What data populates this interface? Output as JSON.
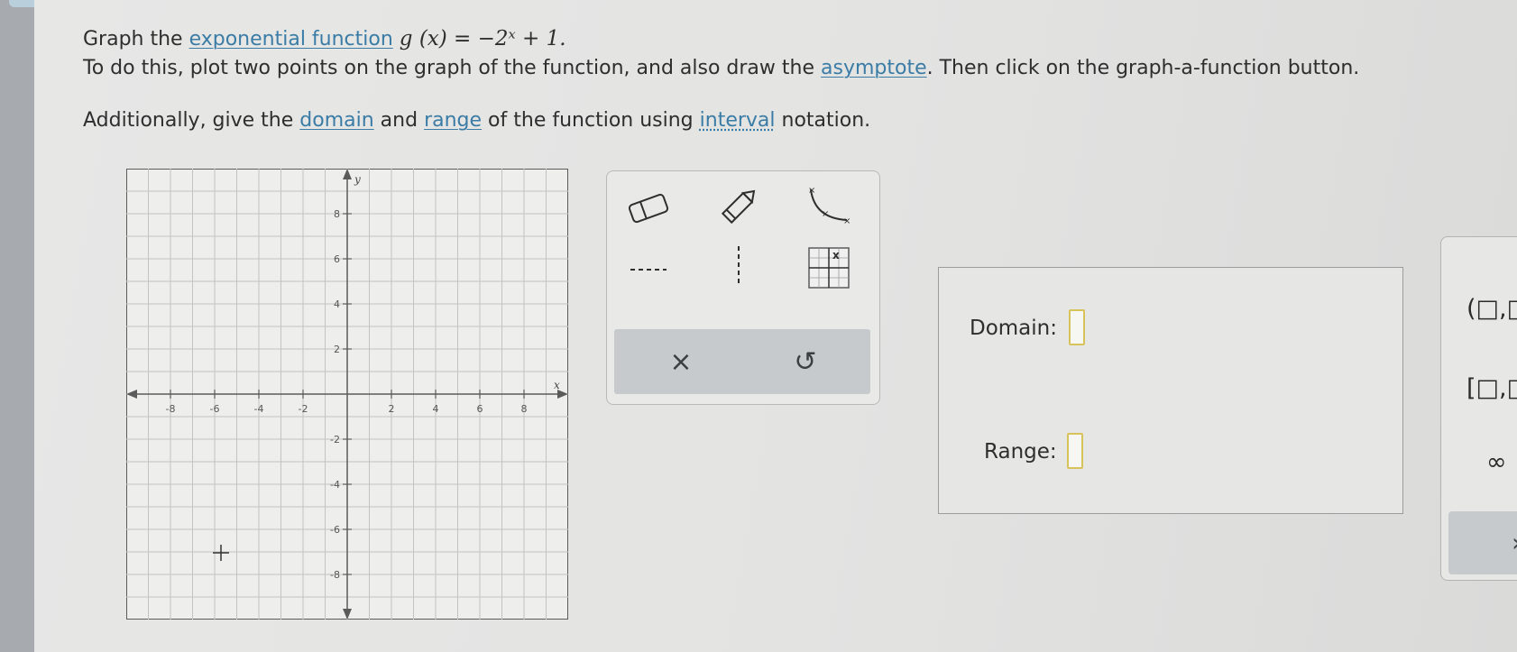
{
  "instructions": {
    "line1_prefix": "Graph the ",
    "line1_link": "exponential function",
    "function_math": "g (x) = −2ˣ + 1.",
    "line2_prefix": "To do this, plot two points on the graph of the function, and also draw the ",
    "line2_link": "asymptote",
    "line2_suffix": ". Then click on the graph-a-function button.",
    "line3_prefix": "Additionally, give the ",
    "line3_link_domain": "domain",
    "line3_and": " and ",
    "line3_link_range": "range",
    "line3_mid": " of the function using ",
    "line3_link_interval": "interval",
    "line3_suffix": " notation."
  },
  "graph": {
    "x_axis_label": "x",
    "y_axis_label": "y",
    "x_range": [
      -10,
      10
    ],
    "y_range": [
      -10,
      10
    ],
    "x_tick_labels": [
      "-8",
      "-6",
      "-4",
      "-2",
      "2",
      "4",
      "6",
      "8"
    ],
    "y_tick_labels": [
      "8",
      "6",
      "4",
      "2",
      "-2",
      "-4",
      "-6",
      "-8"
    ]
  },
  "toolbox": {
    "tools": [
      "eraser-icon",
      "pencil-icon",
      "exponential-curve-icon",
      "horizontal-asymptote-icon",
      "vertical-asymptote-icon",
      "graph-function-icon"
    ],
    "clear_label": "×",
    "undo_label": "↺"
  },
  "answer": {
    "domain_label": "Domain:",
    "range_label": "Range:"
  },
  "keypad": {
    "open_interval": "(□,□",
    "closed_interval": "[□,□",
    "infinity": "∞"
  },
  "colors": {
    "link": "#3a7ca6",
    "answer_box_border": "#d8c35a",
    "toolbar_bar": "#c6cacd"
  }
}
